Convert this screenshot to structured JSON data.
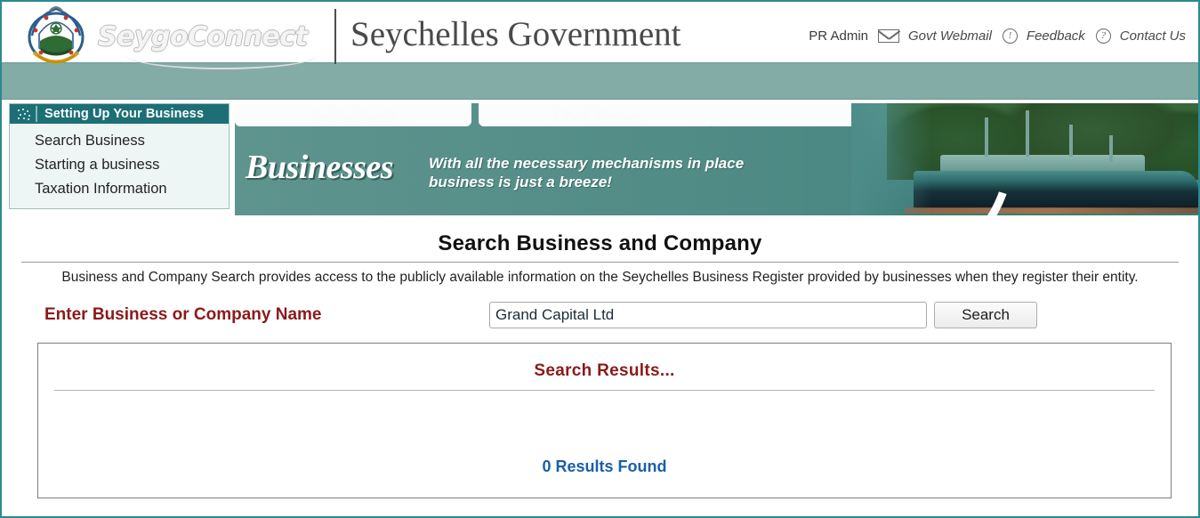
{
  "header": {
    "crest_alt": "seychelles-coat-of-arms",
    "logo_text": "SeygoConnect",
    "site_title": "Seychelles Government",
    "links": [
      {
        "label": "PR Admin",
        "icon": "",
        "type": "text"
      },
      {
        "label": "Govt Webmail",
        "icon": "mail-icon",
        "type": "link"
      },
      {
        "label": "Feedback",
        "icon": "feedback-icon",
        "type": "link"
      },
      {
        "label": "Contact Us",
        "icon": "question-icon",
        "type": "link"
      }
    ]
  },
  "sidebar": {
    "title": "Setting Up Your Business",
    "items": [
      {
        "label": "Search Business"
      },
      {
        "label": "Starting a business"
      },
      {
        "label": "Taxation Information"
      }
    ]
  },
  "banner": {
    "tabs": [
      {
        "label": "Individuals"
      },
      {
        "label": "Civil Status"
      }
    ],
    "word": "Businesses",
    "tagline_line1": "With all the necessary mechanisms in place",
    "tagline_line2": "business is just a breeze!",
    "photo_alt": "harbour-ships-photo"
  },
  "main": {
    "title": "Search Business and Company",
    "intro": "Business and Company Search provides access to the publicly available information on the Seychelles Business Register provided by businesses when they register their entity.",
    "search_label": "Enter Business or Company Name",
    "search_value": "Grand Capital Ltd",
    "search_placeholder": "",
    "search_button": "Search",
    "results_title": "Search Results...",
    "results_count": "0 Results Found"
  },
  "colors": {
    "teal_band": "#83aca6",
    "sidebar_header": "#1d6f76",
    "accent_red": "#8b1a1a",
    "result_blue": "#1a5fa8",
    "page_border": "#2d8a8f"
  }
}
